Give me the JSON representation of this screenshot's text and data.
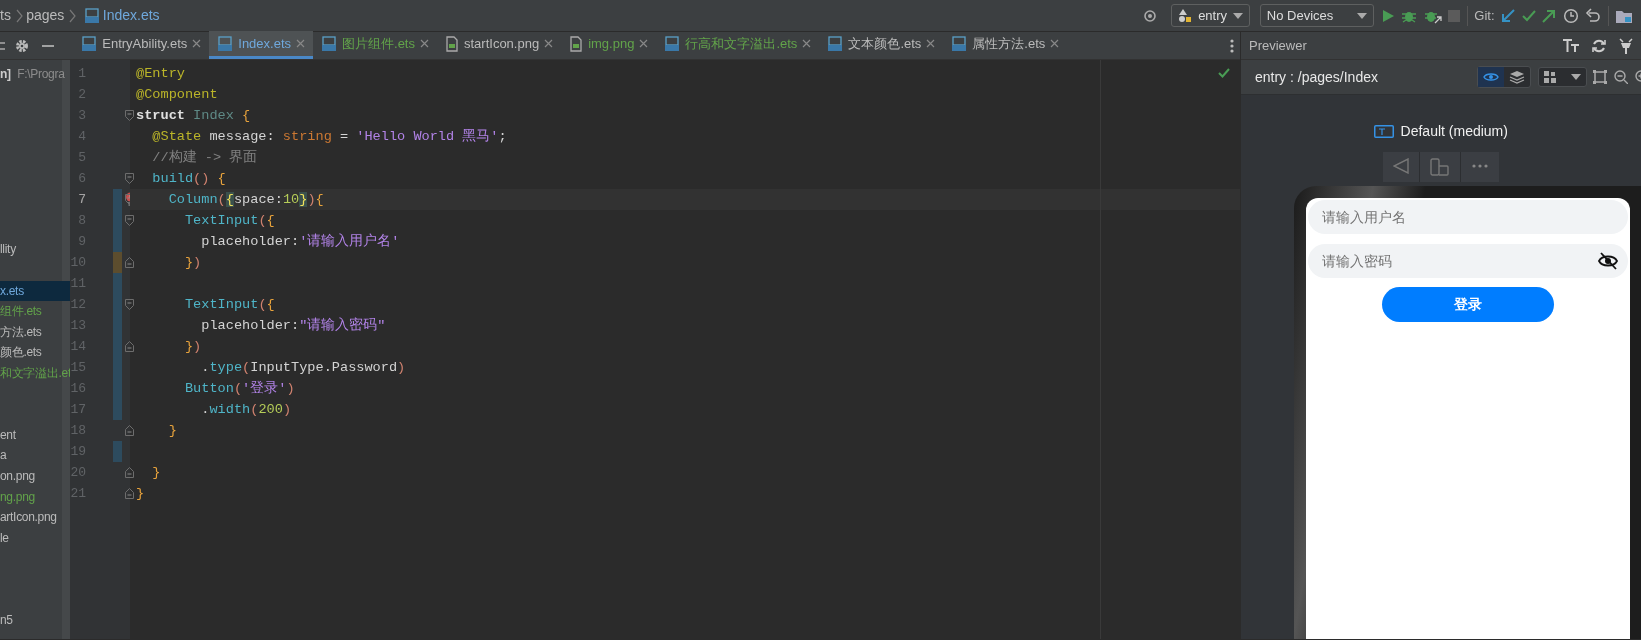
{
  "breadcrumb": [
    {
      "text": "ts",
      "kind": "folder"
    },
    {
      "text": "pages",
      "kind": "folder"
    },
    {
      "text": "Index.ets",
      "kind": "ets"
    }
  ],
  "toolbar": {
    "run_config": "entry",
    "device": "No Devices",
    "git_label": "Git:"
  },
  "project_panel": {
    "header": "n]",
    "path": "F:\\Progra",
    "items": [
      {
        "text": "llity",
        "selected": false,
        "new": false
      },
      {
        "text": "x.ets",
        "selected": true,
        "new": false
      },
      {
        "text": "组件.ets",
        "selected": false,
        "new": true
      },
      {
        "text": "方法.ets",
        "selected": false,
        "new": false
      },
      {
        "text": "颜色.ets",
        "selected": false,
        "new": false
      },
      {
        "text": "和文字溢出.et",
        "selected": false,
        "new": true
      },
      {
        "text": "ent",
        "selected": false,
        "new": false
      },
      {
        "text": "a",
        "selected": false,
        "new": false
      },
      {
        "text": "on.png",
        "selected": false,
        "new": false
      },
      {
        "text": "ng.png",
        "selected": false,
        "new": true
      },
      {
        "text": "artIcon.png",
        "selected": false,
        "new": false
      },
      {
        "text": "le",
        "selected": false,
        "new": false
      },
      {
        "text": "n5",
        "selected": false,
        "new": false
      }
    ]
  },
  "tabs": [
    {
      "label": "EntryAbility.ets",
      "kind": "ets",
      "new": false,
      "selected": false
    },
    {
      "label": "Index.ets",
      "kind": "ets",
      "new": false,
      "selected": true
    },
    {
      "label": "图片组件.ets",
      "kind": "ets",
      "new": true,
      "selected": false
    },
    {
      "label": "startIcon.png",
      "kind": "png",
      "new": false,
      "selected": false
    },
    {
      "label": "img.png",
      "kind": "png",
      "new": true,
      "selected": false
    },
    {
      "label": "行高和文字溢出.ets",
      "kind": "ets",
      "new": true,
      "selected": false
    },
    {
      "label": "文本颜色.ets",
      "kind": "ets",
      "new": false,
      "selected": false
    },
    {
      "label": "属性方法.ets",
      "kind": "ets",
      "new": false,
      "selected": false
    }
  ],
  "code": [
    {
      "number": "1",
      "tokens": [
        {
          "text": "@Entry",
          "kind": "annotation"
        }
      ]
    },
    {
      "number": "2",
      "tokens": [
        {
          "text": "@Component",
          "kind": "annotation"
        }
      ]
    },
    {
      "number": "3",
      "fold_start": true,
      "tokens": [
        {
          "text": "struct ",
          "kind": "keyword"
        },
        {
          "text": "Index ",
          "kind": "class"
        },
        {
          "text": "{",
          "kind": "brace"
        }
      ]
    },
    {
      "number": "4",
      "tokens": [
        {
          "text": "  @State",
          "kind": "annotation"
        },
        {
          "text": " message: ",
          "kind": "plain"
        },
        {
          "text": "string",
          "kind": "type"
        },
        {
          "text": " = ",
          "kind": "plain"
        },
        {
          "text": "'Hello World 黑马'",
          "kind": "string"
        },
        {
          "text": ";",
          "kind": "plain"
        }
      ]
    },
    {
      "number": "5",
      "tokens": [
        {
          "text": "  //构建 -> 界面",
          "kind": "comment"
        }
      ]
    },
    {
      "number": "6",
      "fold_start": true,
      "tokens": [
        {
          "text": "  build",
          "kind": "function"
        },
        {
          "text": "() ",
          "kind": "paren"
        },
        {
          "text": "{",
          "kind": "brace"
        }
      ]
    },
    {
      "number": "7",
      "fold_start": true,
      "current": true,
      "error": true,
      "added": true,
      "tokens": [
        {
          "text": "    Column",
          "kind": "function"
        },
        {
          "text": "(",
          "kind": "paren"
        },
        {
          "text": "{",
          "kind": "match"
        },
        {
          "text": "space:",
          "kind": "plain"
        },
        {
          "text": "10",
          "kind": "number"
        },
        {
          "text": "}",
          "kind": "match"
        },
        {
          "text": ")",
          "kind": "paren"
        },
        {
          "text": "{",
          "kind": "brace"
        }
      ]
    },
    {
      "number": "8",
      "fold_start": true,
      "added": true,
      "tokens": [
        {
          "text": "      TextInput",
          "kind": "function"
        },
        {
          "text": "(",
          "kind": "paren"
        },
        {
          "text": "{",
          "kind": "brace"
        }
      ]
    },
    {
      "number": "9",
      "added": true,
      "tokens": [
        {
          "text": "        placeholder:",
          "kind": "plain"
        },
        {
          "text": "'请输入用户名'",
          "kind": "string"
        }
      ]
    },
    {
      "number": "10",
      "fold_end": true,
      "modified": true,
      "tokens": [
        {
          "text": "      }",
          "kind": "brace"
        },
        {
          "text": ")",
          "kind": "paren"
        }
      ]
    },
    {
      "number": "11",
      "added": true
    },
    {
      "number": "12",
      "fold_start": true,
      "added": true,
      "tokens": [
        {
          "text": "      TextInput",
          "kind": "function"
        },
        {
          "text": "(",
          "kind": "paren"
        },
        {
          "text": "{",
          "kind": "brace"
        }
      ]
    },
    {
      "number": "13",
      "added": true,
      "tokens": [
        {
          "text": "        placeholder:",
          "kind": "plain"
        },
        {
          "text": "\"请输入密码\"",
          "kind": "string"
        }
      ]
    },
    {
      "number": "14",
      "fold_end": true,
      "added": true,
      "tokens": [
        {
          "text": "      }",
          "kind": "brace"
        },
        {
          "text": ")",
          "kind": "paren"
        }
      ]
    },
    {
      "number": "15",
      "added": true,
      "tokens": [
        {
          "text": "        .",
          "kind": "plain"
        },
        {
          "text": "type",
          "kind": "function"
        },
        {
          "text": "(",
          "kind": "paren"
        },
        {
          "text": "InputType.Password",
          "kind": "plain"
        },
        {
          "text": ")",
          "kind": "paren"
        }
      ]
    },
    {
      "number": "16",
      "added": true,
      "tokens": [
        {
          "text": "      Button",
          "kind": "function"
        },
        {
          "text": "(",
          "kind": "paren"
        },
        {
          "text": "'登录'",
          "kind": "string"
        },
        {
          "text": ")",
          "kind": "paren"
        }
      ]
    },
    {
      "number": "17",
      "added": true,
      "tokens": [
        {
          "text": "        .",
          "kind": "plain"
        },
        {
          "text": "width",
          "kind": "function"
        },
        {
          "text": "(",
          "kind": "paren"
        },
        {
          "text": "200",
          "kind": "number"
        },
        {
          "text": ")",
          "kind": "paren"
        }
      ]
    },
    {
      "number": "18",
      "fold_end": true,
      "tokens": [
        {
          "text": "    }",
          "kind": "brace"
        }
      ]
    },
    {
      "number": "19",
      "added": true
    },
    {
      "number": "20",
      "fold_end": true,
      "tokens": [
        {
          "text": "  }",
          "kind": "brace"
        }
      ]
    },
    {
      "number": "21",
      "fold_end": true,
      "tokens": [
        {
          "text": "}",
          "kind": "brace"
        }
      ]
    }
  ],
  "previewer": {
    "title": "Previewer",
    "page_path": "entry : /pages/Index",
    "view_modes": [
      {
        "kind": "inspect",
        "selected": true
      },
      {
        "kind": "layers",
        "selected": false
      }
    ],
    "device_label": "Default (medium)",
    "app": {
      "fields": [
        {
          "placeholder": "请输入用户名",
          "kind": "text"
        },
        {
          "placeholder": "请输入密码",
          "kind": "password"
        }
      ],
      "button": "登录"
    }
  }
}
